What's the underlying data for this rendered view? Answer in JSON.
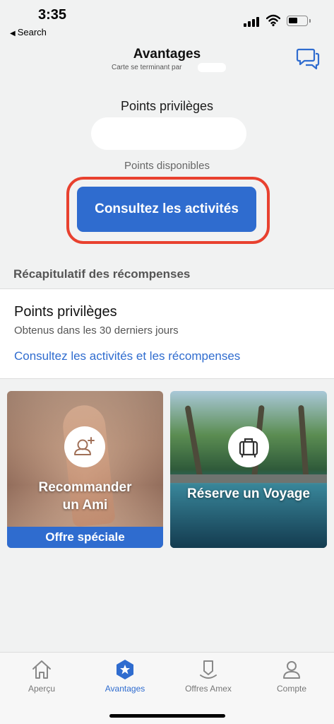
{
  "status_bar": {
    "time": "3:35",
    "back_label": "Search",
    "back_icon": "back-triangle"
  },
  "header": {
    "title": "Avantages",
    "subtitle": "Carte se terminant par",
    "chat_icon": "chat-bubbles-icon"
  },
  "points": {
    "title": "Points privilèges",
    "available_label": "Points disponibles",
    "cta_label": "Consultez les activités"
  },
  "recap": {
    "heading": "Récapitulatif des récompenses",
    "title": "Points privilèges",
    "subtitle": "Obtenus dans les 30 derniers jours",
    "link": "Consultez les activités et les récompenses"
  },
  "tiles": [
    {
      "label_line1": "Recommander",
      "label_line2": "un Ami",
      "badge": "Offre spéciale",
      "icon": "add-person-icon"
    },
    {
      "label": "Réserve un Voyage",
      "icon": "suitcase-icon"
    }
  ],
  "nav": {
    "items": [
      {
        "label": "Aperçu",
        "icon": "home-icon"
      },
      {
        "label": "Avantages",
        "icon": "star-badge-icon",
        "active": true
      },
      {
        "label": "Offres Amex",
        "icon": "offer-tag-icon"
      },
      {
        "label": "Compte",
        "icon": "person-icon"
      }
    ]
  },
  "colors": {
    "accent": "#2f6ccf",
    "highlight": "#e8412f",
    "background": "#f1f2f2"
  }
}
